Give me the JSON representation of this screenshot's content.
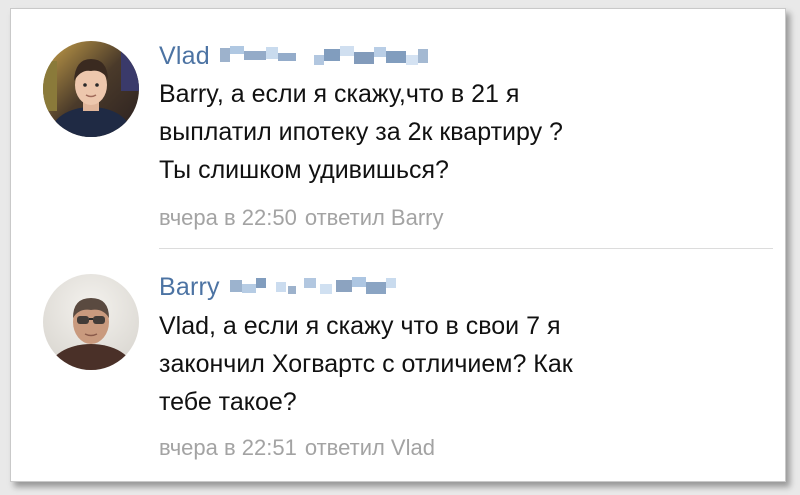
{
  "colors": {
    "author": "#4c73a3",
    "text": "#111111",
    "meta": "#a3a3a3",
    "separator": "#dcdcdc"
  },
  "comments": [
    {
      "author": "Vlad",
      "text_lines": [
        "Barry, а если я скажу,что в 21 я",
        "выплатил ипотеку за 2к квартиру ?",
        "Ты слишком удивишься?"
      ],
      "date": "вчера в 22:50",
      "reply": "ответил Barry"
    },
    {
      "author": "Barry",
      "text_lines": [
        "Vlad, а если я скажу что в свои 7 я",
        "закончил Хогвартс с отличием? Как",
        "тебе такое?"
      ],
      "date": "вчера в 22:51",
      "reply": "ответил Vlad"
    }
  ]
}
